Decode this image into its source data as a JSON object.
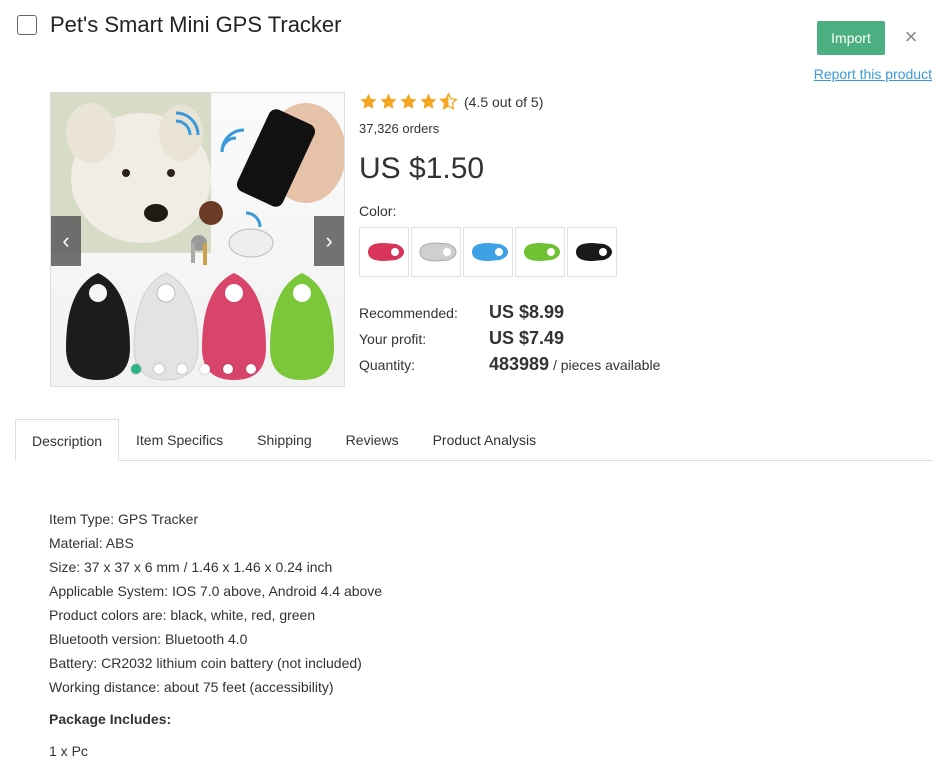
{
  "product": {
    "title": "Pet's Smart Mini GPS Tracker",
    "rating_value": 4.5,
    "rating_text": "(4.5 out of 5)",
    "orders_text": "37,326 orders",
    "price": "US $1.50",
    "color_label": "Color:",
    "colors": [
      {
        "name": "red",
        "hex": "#d9345a"
      },
      {
        "name": "white",
        "hex": "#d8d8d8"
      },
      {
        "name": "blue",
        "hex": "#3ea1e6"
      },
      {
        "name": "green",
        "hex": "#6fc233"
      },
      {
        "name": "black",
        "hex": "#1a1a1a"
      }
    ],
    "recommended_label": "Recommended:",
    "recommended_value": "US $8.99",
    "profit_label": "Your profit:",
    "profit_value": "US $7.49",
    "quantity_label": "Quantity:",
    "quantity_value": "483989",
    "quantity_suffix": " / pieces available"
  },
  "actions": {
    "import_label": "Import",
    "close_icon": "×",
    "report_label": "Report this product"
  },
  "gallery": {
    "prev_icon": "‹",
    "next_icon": "›",
    "active_index": 0,
    "image_count": 6
  },
  "tabs": [
    "Description",
    "Item Specifics",
    "Shipping",
    "Reviews",
    "Product Analysis"
  ],
  "description": {
    "lines": [
      "Item Type: GPS Tracker",
      "Material: ABS",
      "Size: 37 x 37 x 6 mm / 1.46 x 1.46 x 0.24 inch",
      "Applicable System: IOS 7.0 above, Android 4.4 above",
      "Product colors are: black, white, red, green",
      "Bluetooth version: Bluetooth 4.0",
      "Battery: CR2032 lithium coin battery (not included)",
      "Working distance: about 75 feet (accessibility)"
    ],
    "package_heading": "Package Includes:",
    "package_item": "1 x Pc"
  },
  "colors": {
    "accent": "#4caf82",
    "link": "#3a9ad9",
    "star": "#f5a623",
    "active_dot": "#2db38a"
  }
}
